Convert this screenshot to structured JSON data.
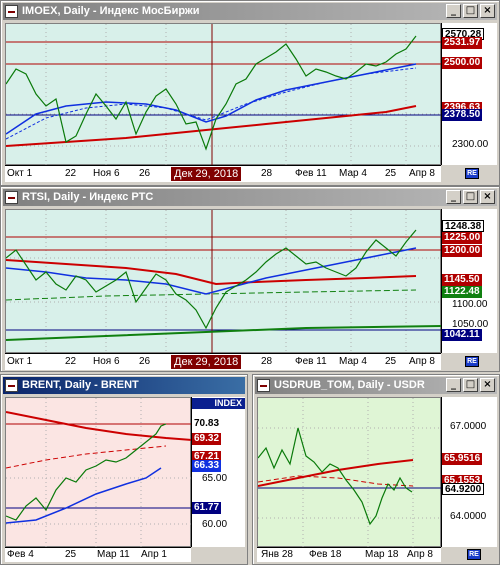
{
  "windows": {
    "imoex": {
      "title": "IMOEX, Daily - Индекс МосБиржи",
      "y_ticks": [
        "2300.00"
      ],
      "price_tags": [
        "2570.28",
        "2531.97",
        "2500.00",
        "2396.63",
        "2378.50"
      ],
      "x_ticks": [
        "Окт 1",
        "22",
        "Ноя 6",
        "26",
        "28",
        "Фев 11",
        "Мар 4",
        "25",
        "Апр 8"
      ],
      "crosshair_date": "Дек 29, 2018"
    },
    "rtsi": {
      "title": "RTSI, Daily - Индекс РТС",
      "y_ticks": [
        "1100.00",
        "1050.00"
      ],
      "price_tags": [
        "1248.38",
        "1225.00",
        "1200.00",
        "1145.50",
        "1122.48",
        "1042.11"
      ],
      "x_ticks": [
        "Окт 1",
        "22",
        "Ноя 6",
        "26",
        "28",
        "Фев 11",
        "Мар 4",
        "25",
        "Апр 8"
      ],
      "crosshair_date": "Дек 29, 2018"
    },
    "brent": {
      "title": "BRENT, Daily - BRENT",
      "index_label": "INDEX",
      "y_ticks": [
        "65.00",
        "60.00"
      ],
      "price_tags": [
        "70.83",
        "69.32",
        "67.21",
        "66.33",
        "61.77"
      ],
      "x_ticks": [
        "Фев 4",
        "25",
        "Мар 11",
        "Апр 1"
      ]
    },
    "usdrub": {
      "title": "USDRUB_TOM, Daily - USDR",
      "y_ticks": [
        "67.0000",
        "64.0000"
      ],
      "price_tags": [
        "65.9516",
        "65.1553",
        "64.9200"
      ],
      "x_ticks": [
        "Янв 28",
        "Фев 18",
        "Мар 18",
        "Апр 8"
      ]
    }
  },
  "colors": {
    "bg_imoex": "#d8f0ea",
    "bg_rtsi": "#d8f0ea",
    "bg_brent": "#fbe5e3",
    "bg_usdrub": "#dff5d5",
    "candle": "#0a7a0a",
    "ma_red": "#cc0000",
    "ma_blue": "#1030e0",
    "ma_green": "#108010",
    "level_red": "#b00000",
    "level_navy": "#000080"
  },
  "icons": {
    "window_controls": [
      "minimize-icon",
      "maximize-icon",
      "close-icon"
    ],
    "scroll": "scroll-right-icon"
  }
}
